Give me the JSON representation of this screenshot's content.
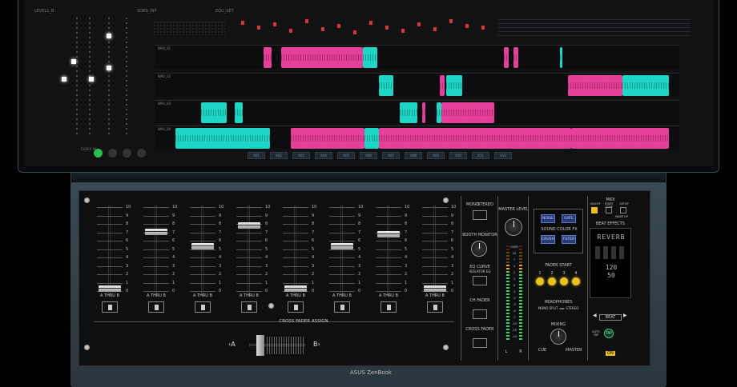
{
  "screen": {
    "top_labels": [
      "LEVEL1_B",
      "SORS_INP",
      "EQU_SET"
    ],
    "tracks": [
      {
        "label": "WAV_01",
        "clips": [
          {
            "c": "pink"
          },
          {
            "c": "pink"
          },
          {
            "c": "cyan"
          },
          {
            "c": "pink"
          },
          {
            "c": "pink"
          },
          {
            "c": "cyan"
          }
        ]
      },
      {
        "label": "WAV_02",
        "clips": [
          {
            "c": "cyan"
          },
          {
            "c": "pink"
          },
          {
            "c": "cyan"
          },
          {
            "c": "pink"
          },
          {
            "c": "cyan"
          }
        ]
      },
      {
        "label": "WAV_03",
        "clips": [
          {
            "c": "cyan"
          },
          {
            "c": "cyan"
          },
          {
            "c": "cyan"
          },
          {
            "c": "pink"
          },
          {
            "c": "cyan"
          },
          {
            "c": "pink"
          }
        ]
      },
      {
        "label": "WAV_04",
        "clips": [
          {
            "c": "cyan"
          },
          {
            "c": "pink"
          },
          {
            "c": "pink"
          },
          {
            "c": "cyan"
          },
          {
            "c": "pink"
          }
        ]
      }
    ],
    "bottom_buttons": [
      "A01",
      "A02",
      "A03",
      "A04",
      "A05",
      "A06",
      "A07",
      "A08",
      "A09",
      "A10",
      "A11",
      "A12"
    ],
    "left_status": "CLOCK IN"
  },
  "mixer": {
    "channels": [
      {
        "scale": [
          "10",
          "9",
          "8",
          "7",
          "6",
          "5",
          "4",
          "3",
          "2",
          "1",
          "0"
        ],
        "assign": "A  THRU  B",
        "fader_level": 0.05
      },
      {
        "scale": [
          "10",
          "9",
          "8",
          "7",
          "6",
          "5",
          "4",
          "3",
          "2",
          "1",
          "0"
        ],
        "assign": "A  THRU  B",
        "fader_level": 0.72
      },
      {
        "scale": [
          "10",
          "9",
          "8",
          "7",
          "6",
          "5",
          "4",
          "3",
          "2",
          "1",
          "0"
        ],
        "assign": "A  THRU  B",
        "fader_level": 0.55
      },
      {
        "scale": [
          "10",
          "9",
          "8",
          "7",
          "6",
          "5",
          "4",
          "3",
          "2",
          "1",
          "0"
        ],
        "assign": "A  THRU  B",
        "fader_level": 0.8
      },
      {
        "scale": [
          "10",
          "9",
          "8",
          "7",
          "6",
          "5",
          "4",
          "3",
          "2",
          "1",
          "0"
        ],
        "assign": "A  THRU  B",
        "fader_level": 0.05
      },
      {
        "scale": [
          "10",
          "9",
          "8",
          "7",
          "6",
          "5",
          "4",
          "3",
          "2",
          "1",
          "0"
        ],
        "assign": "A  THRU  B",
        "fader_level": 0.55
      },
      {
        "scale": [
          "10",
          "9",
          "8",
          "7",
          "6",
          "5",
          "4",
          "3",
          "2",
          "1",
          "0"
        ],
        "assign": "A  THRU  B",
        "fader_level": 0.7
      },
      {
        "scale": [
          "10",
          "9",
          "8",
          "7",
          "6",
          "5",
          "4",
          "3",
          "2",
          "1",
          "0"
        ],
        "assign": "A  THRU  B",
        "fader_level": 0.05
      }
    ],
    "crossfader": {
      "label": "CROSS FADER ASSIGN",
      "a": "‹A",
      "b": "B›",
      "position": 0.15
    },
    "mono_stereo": {
      "mono": "MONO",
      "stereo": "STEREO"
    },
    "booth_monitor": "BOOTH MONITOR",
    "eq_curve": {
      "label": "EQ CURVE",
      "options": "ISOLATOR  EQ"
    },
    "ch_fader": "CH FADER",
    "cross_fader": "CROSS FADER",
    "master_level": "MASTER LEVEL",
    "meter_labels": [
      "OVER",
      "10",
      "7",
      "4",
      "2",
      "1",
      "0",
      "-1",
      "-2",
      "-3",
      "-4",
      "-7",
      "-10",
      "-15",
      "-24"
    ],
    "lr": {
      "l": "L",
      "r": "R"
    },
    "sound_color_fx": {
      "label": "SOUND COLOR FX",
      "buttons": [
        "NOISE",
        "GATE",
        "CRUSH",
        "FILTER"
      ]
    },
    "fader_start": {
      "label": "FADER START",
      "nums": [
        "1",
        "2",
        "3",
        "4"
      ]
    },
    "headphones": {
      "label": "HEADPHONES",
      "mode": "MONO SPLIT ◄ ► STEREO",
      "mixing": "MIXING",
      "cue": "CUE",
      "master": "MASTER"
    },
    "midi": {
      "label": "MIDI",
      "on_off": "ON/OFF",
      "start_stop": "START STOP",
      "setup": "SETUP",
      "wake_up": "WAKE UP"
    },
    "beat_effects": {
      "label": "BEAT EFFECTS",
      "effect": "REVERB",
      "bpm": "120",
      "value": "50",
      "beat": "BEAT",
      "tap": "TAP",
      "auto_tap": "AUTO TAP",
      "on": "ON"
    }
  },
  "brand": "ASUS ZenBook"
}
